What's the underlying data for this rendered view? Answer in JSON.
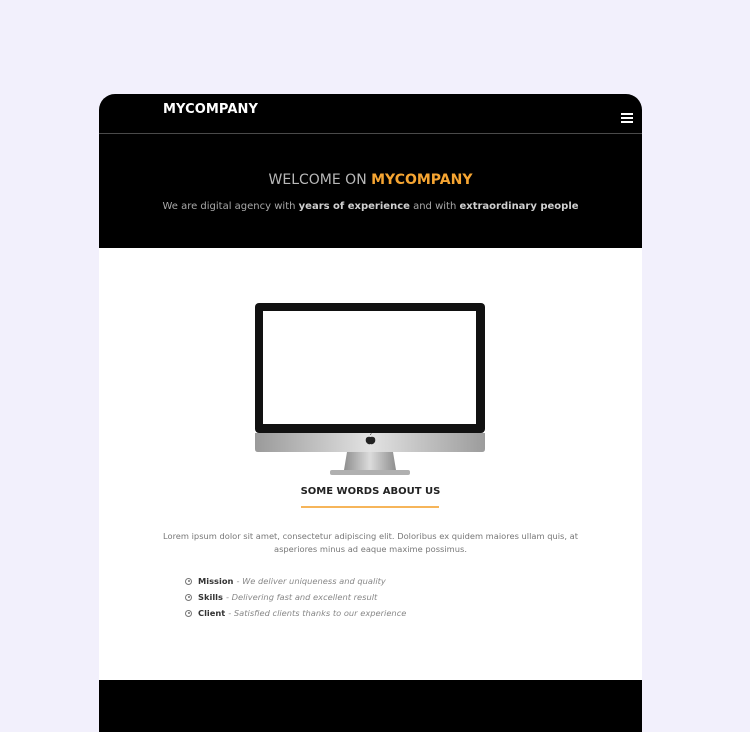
{
  "navbar": {
    "brand": "MYCOMPANY",
    "menu_icon": "hamburger-menu-icon"
  },
  "hero": {
    "title_prefix": "WELCOME ON ",
    "title_accent": "MYCOMPANY",
    "subtitle_part1": "We are digital agency with ",
    "subtitle_bold1": "years of experience",
    "subtitle_part2": " and with ",
    "subtitle_bold2": "extraordinary people"
  },
  "about": {
    "title": "SOME WORDS ABOUT US",
    "text": "Lorem ipsum dolor sit amet, consectetur adipiscing elit. Doloribus ex quidem maiores ullam quis, at asperiores minus ad eaque maxime possimus.",
    "features": [
      {
        "name": "Mission",
        "desc": "- We deliver uniqueness and quality"
      },
      {
        "name": "Skills",
        "desc": "- Delivering fast and excellent result"
      },
      {
        "name": "Client",
        "desc": "- Satisfied clients thanks to our experience"
      }
    ]
  },
  "colors": {
    "accent": "#f6a532",
    "background": "#f2f0fc",
    "dark": "#000000"
  }
}
